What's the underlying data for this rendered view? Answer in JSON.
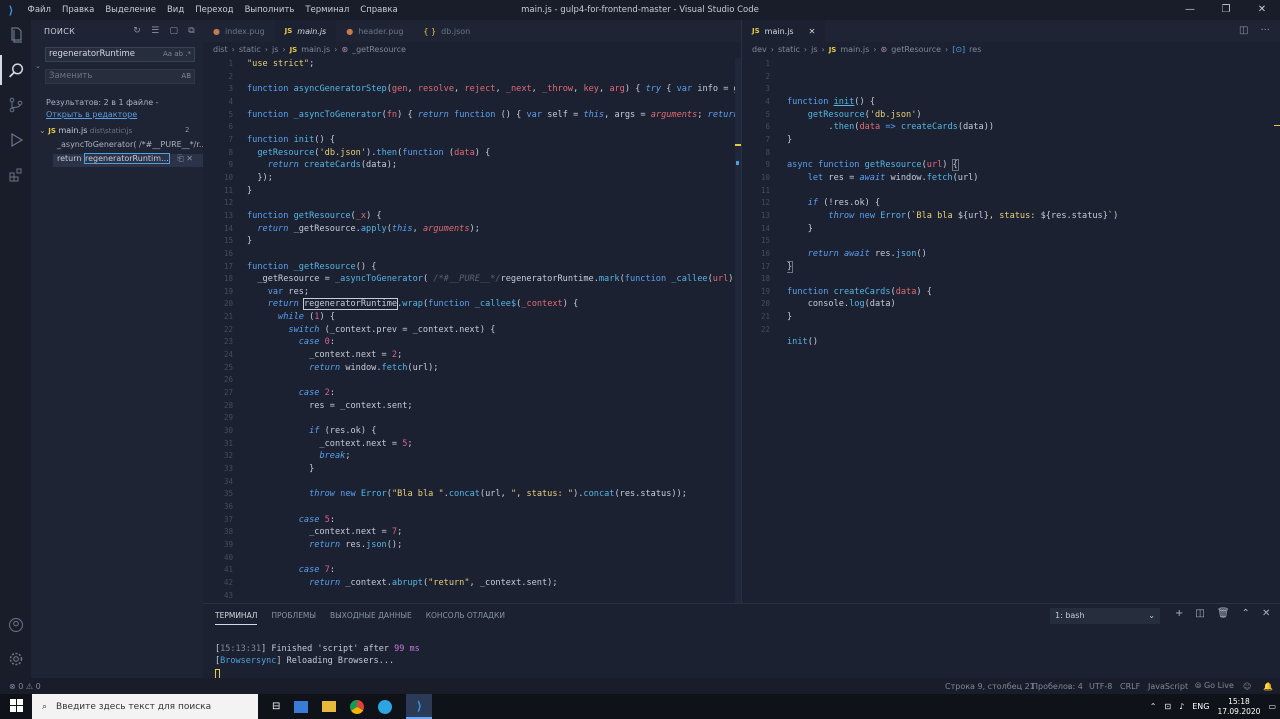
{
  "titlebar": {
    "menu": [
      "Файл",
      "Правка",
      "Выделение",
      "Вид",
      "Переход",
      "Выполнить",
      "Терминал",
      "Справка"
    ],
    "title": "main.js - gulp4-for-frontend-master - Visual Studio Code"
  },
  "sidebar": {
    "header": "ПОИСК",
    "search_value": "regeneratorRuntime",
    "search_opts": "Aa  ab  .*",
    "replace_placeholder": "Заменить",
    "replace_opts": "AB",
    "results_text": "Результатов: 2 в 1 файле - ",
    "open_link": "Открыть в редакторе",
    "file_name": "main.js",
    "file_path": "dist\\static\\js",
    "file_count": "2",
    "match1": "_asyncToGenerator( /*#__PURE__*/r...",
    "match2_prefix": "return ",
    "match2_term": "regeneratorRuntim..."
  },
  "left_editor": {
    "tabs": [
      "index.pug",
      "main.js",
      "header.pug",
      "db.json"
    ],
    "breadcrumb": [
      "dist",
      "static",
      "js",
      "main.js",
      "_getResource"
    ]
  },
  "right_editor": {
    "tab": "main.js",
    "breadcrumb": [
      "dev",
      "static",
      "js",
      "main.js",
      "getResource",
      "res"
    ]
  },
  "panel": {
    "tabs": [
      "ТЕРМИНАЛ",
      "ПРОБЛЕМЫ",
      "ВЫХОДНЫЕ ДАННЫЕ",
      "КОНСОЛЬ ОТЛАДКИ"
    ],
    "terminal_select": "1: bash",
    "line1_time": "15:13:31",
    "line1_text": " Finished 'script' after ",
    "line1_dur": "99 ms",
    "line2_tag": "Browsersync",
    "line2_text": " Reloading Browsers..."
  },
  "statusbar": {
    "problems": "⊗ 0  ⚠ 0",
    "position": "Строка 9, столбец 21",
    "spaces": "Пробелов: 4",
    "encoding": "UTF-8",
    "eol": "CRLF",
    "language": "JavaScript",
    "golive": "⦾ Go Live"
  },
  "taskbar": {
    "search_placeholder": "Введите здесь текст для поиска",
    "lang": "ENG",
    "time": "15:18",
    "date": "17.09.2020"
  },
  "colors": {
    "accent": "#5aa0f0",
    "background": "#1b2130",
    "sidebar": "#1e2433",
    "titlebar": "#181d29"
  }
}
